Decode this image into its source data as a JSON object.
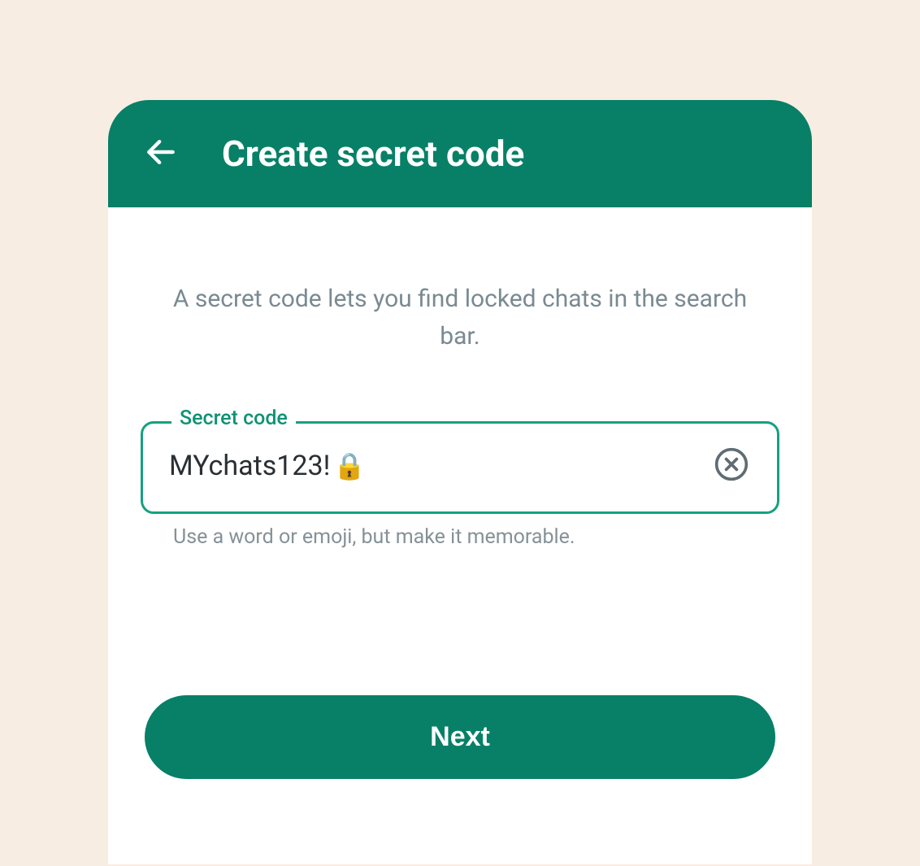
{
  "header": {
    "title": "Create secret code"
  },
  "main": {
    "description": "A secret code lets you find locked chats in the search bar.",
    "field": {
      "label": "Secret code",
      "value": "MYchats123!",
      "lock_emoji": "🔒",
      "helper": "Use a word or emoji, but make it memorable."
    },
    "next_label": "Next"
  },
  "colors": {
    "brand": "#078067",
    "field_border": "#16a181",
    "bg": "#f8ede2",
    "text_muted": "#7a8a91"
  }
}
